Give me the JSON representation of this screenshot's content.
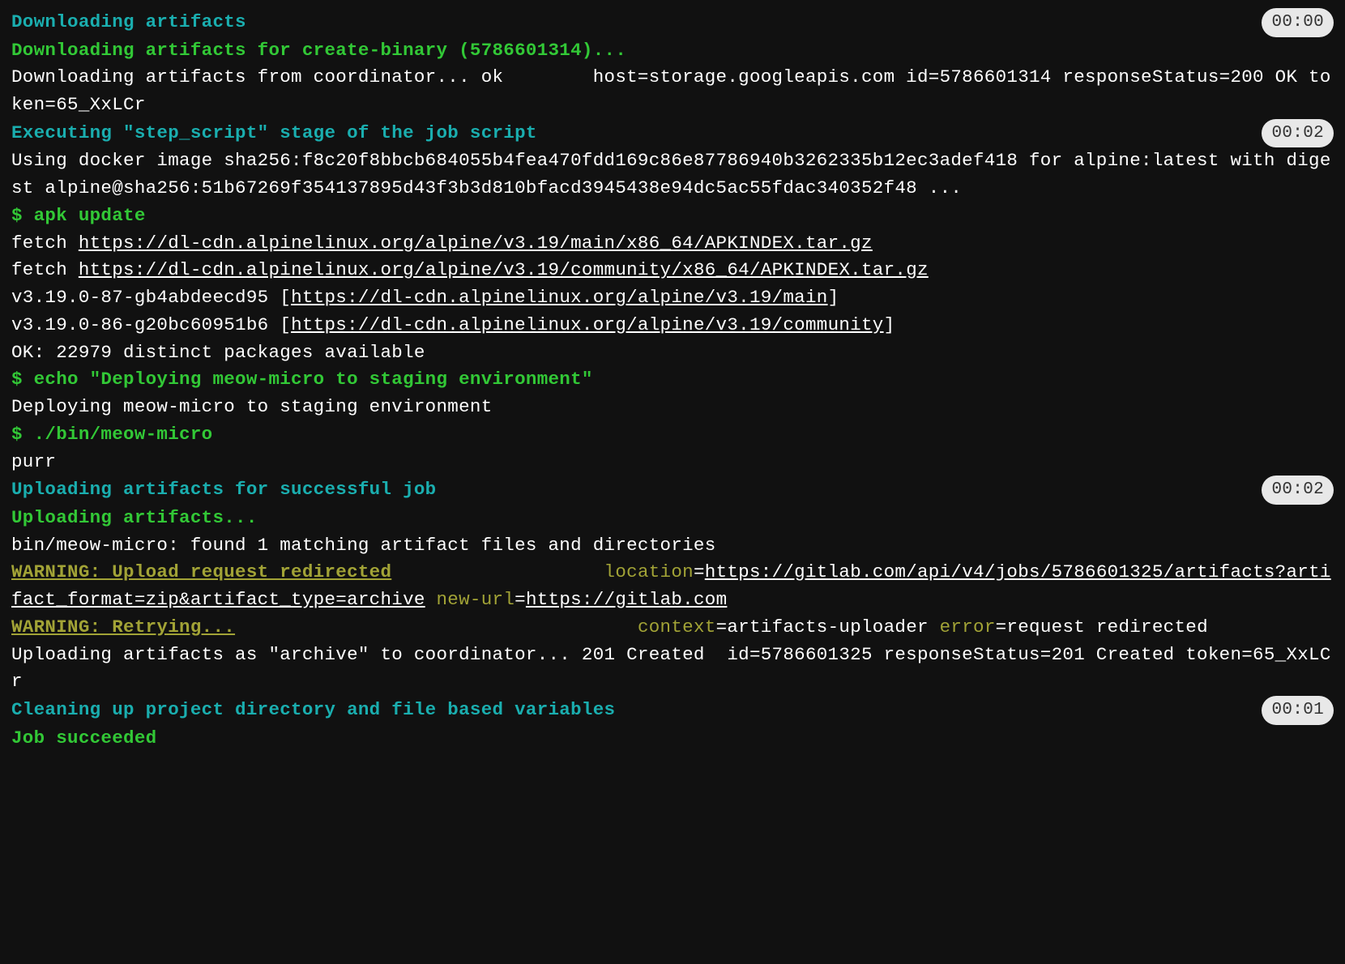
{
  "sections": {
    "s0": {
      "title": "Downloading artifacts",
      "time": "00:00"
    },
    "s1": {
      "title": "Executing \"step_script\" stage of the job script",
      "time": "00:02"
    },
    "s2": {
      "title": "Uploading artifacts for successful job",
      "time": "00:02"
    },
    "s3": {
      "title": "Cleaning up project directory and file based variables",
      "time": "00:01"
    }
  },
  "lines": {
    "l1": "Downloading artifacts for create-binary (5786601314)...",
    "l2": "Downloading artifacts from coordinator... ok        host=storage.googleapis.com id=5786601314 responseStatus=200 OK token=65_XxLCr",
    "l3": "Using docker image sha256:f8c20f8bbcb684055b4fea470fdd169c86e87786940b3262335b12ec3adef418 for alpine:latest with digest alpine@sha256:51b67269f354137895d43f3b3d810bfacd3945438e94dc5ac55fdac340352f48 ...",
    "l4_cmd": "$ apk update",
    "l5a": "fetch ",
    "l5b": "https://dl-cdn.alpinelinux.org/alpine/v3.19/main/x86_64/APKINDEX.tar.gz",
    "l6a": "fetch ",
    "l6b": "https://dl-cdn.alpinelinux.org/alpine/v3.19/community/x86_64/APKINDEX.tar.gz",
    "l7a": "v3.19.0-87-gb4abdeecd95 [",
    "l7b": "https://dl-cdn.alpinelinux.org/alpine/v3.19/main",
    "l7c": "]",
    "l8a": "v3.19.0-86-g20bc60951b6 [",
    "l8b": "https://dl-cdn.alpinelinux.org/alpine/v3.19/community",
    "l8c": "]",
    "l9": "OK: 22979 distinct packages available",
    "l10_cmd": "$ echo \"Deploying meow-micro to staging environment\"",
    "l11": "Deploying meow-micro to staging environment",
    "l12_cmd": "$ ./bin/meow-micro",
    "l13": "purr",
    "l14": "Uploading artifacts...",
    "l15": "bin/meow-micro: found 1 matching artifact files and directories ",
    "l16a": "WARNING: Upload request redirected",
    "l16sp": "                   ",
    "l16b": "location",
    "l16c": "=",
    "l16d": "https://gitlab.com/api/v4/jobs/5786601325/artifacts?artifact_format=zip&artifact_type=archive",
    "l16sp2": " ",
    "l16e": "new-url",
    "l16f": "=",
    "l16g": "https://gitlab.com",
    "l17a": "WARNING: Retrying...",
    "l17sp": "                                    ",
    "l17b": "context",
    "l17c": "=artifacts-uploader ",
    "l17d": "error",
    "l17e": "=request redirected",
    "l18": "Uploading artifacts as \"archive\" to coordinator... 201 Created  id=5786601325 responseStatus=201 Created token=65_XxLCr",
    "l19": "Job succeeded"
  }
}
